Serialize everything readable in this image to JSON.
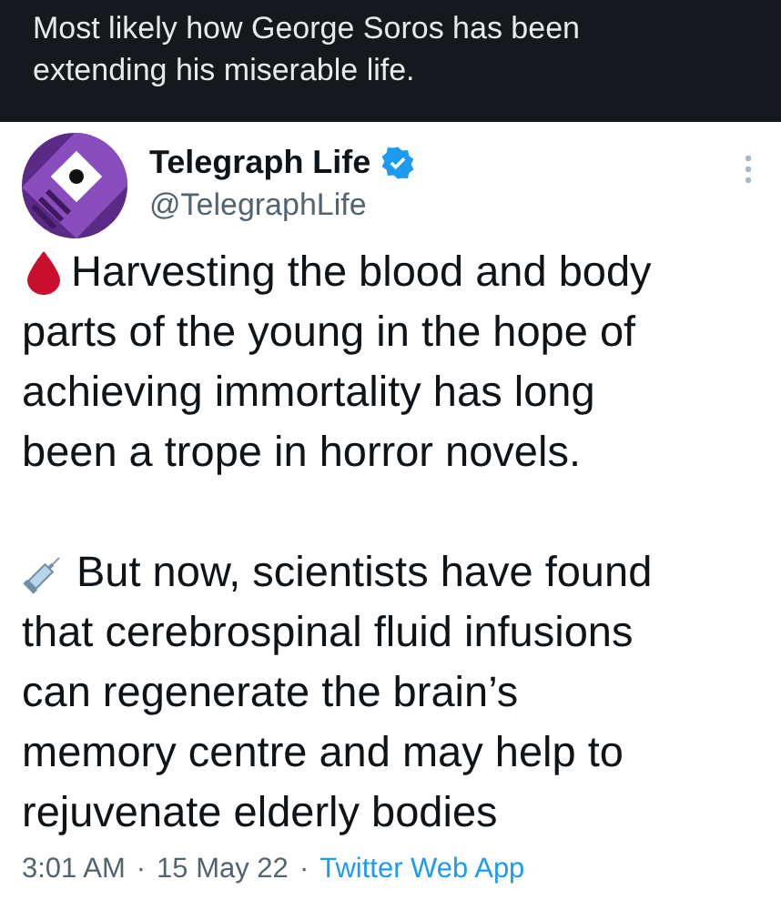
{
  "quote_banner": {
    "text": "Most likely how George Soros has been extending his miserable life."
  },
  "tweet": {
    "author": {
      "name": "Telegraph Life",
      "verified": true,
      "handle": "@TelegraphLife"
    },
    "paragraphs": [
      {
        "kind": "blood",
        "lines": [
          "Harvesting the blood and body",
          "parts of the young in the hope of",
          "achieving immortality has long",
          "been a trope in horror novels."
        ]
      },
      {
        "kind": "syringe",
        "lines": [
          "But now, scientists have found",
          "that cerebrospinal fluid infusions",
          "can regenerate the brain’s",
          "memory centre and may help to",
          "rejuvenate elderly bodies"
        ]
      }
    ],
    "meta": {
      "time": "3:01 AM",
      "separator_1": "·",
      "date": "15 May 22",
      "separator_2": "·",
      "source": "Twitter Web App"
    }
  }
}
